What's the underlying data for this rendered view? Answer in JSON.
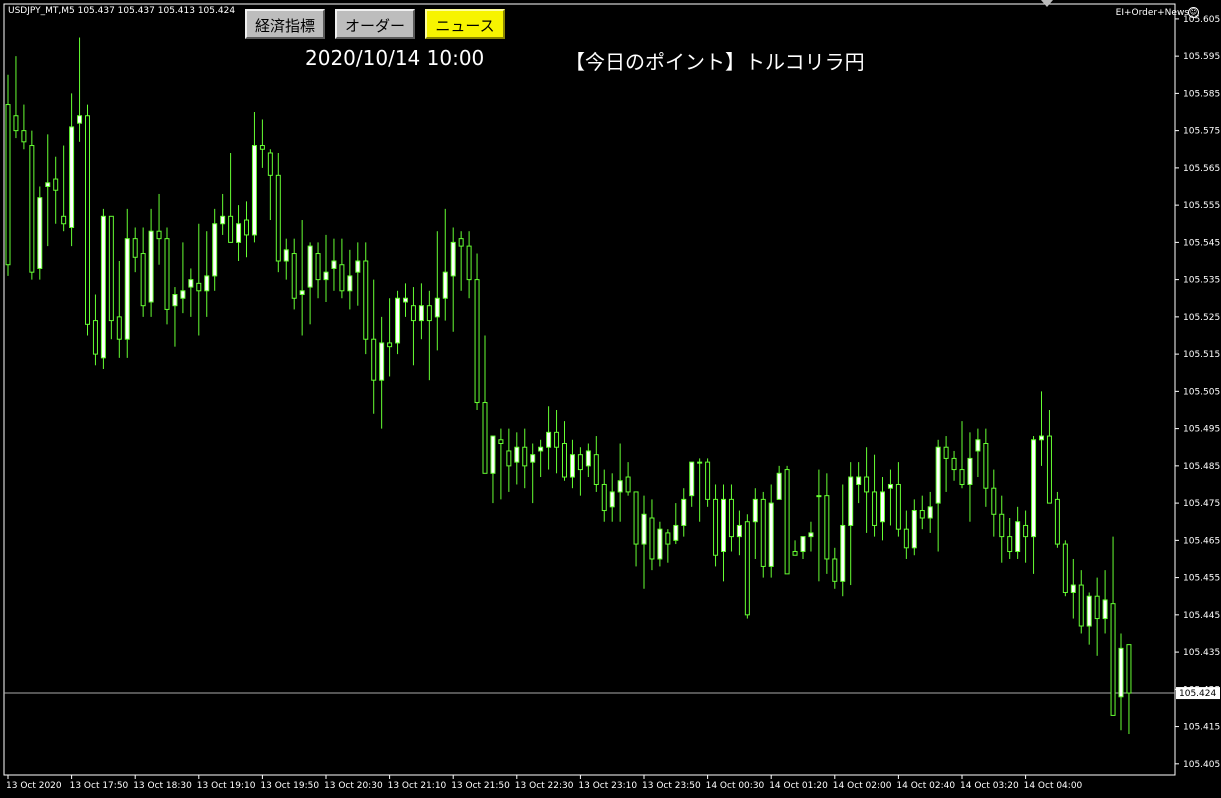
{
  "header": {
    "symbol_info": "USDJPY_MT,M5  105.437 105.437 105.413 105.424",
    "ea_label": "EI+Order+News",
    "ea_icon": "smiley-icon"
  },
  "buttons": {
    "indicators": "経済指標",
    "order": "オーダー",
    "news": "ニュース"
  },
  "news": {
    "time": "2020/10/14 10:00",
    "title": "【今日のポイント】トルコリラ円"
  },
  "colors": {
    "background": "#000000",
    "bull_body": "#ffffff",
    "bear_body": "#000000",
    "wick": "#66ff33",
    "axis": "#ffffff",
    "price_line": "#aaaaaa",
    "news_button": "#f7f400"
  },
  "chart_data": {
    "type": "candlestick",
    "symbol": "USDJPY_MT",
    "timeframe": "M5",
    "ylim": [
      105.402,
      105.609
    ],
    "yticks": [
      "105.605",
      "105.595",
      "105.585",
      "105.575",
      "105.565",
      "105.555",
      "105.545",
      "105.535",
      "105.525",
      "105.515",
      "105.505",
      "105.495",
      "105.485",
      "105.475",
      "105.465",
      "105.455",
      "105.445",
      "105.435",
      "105.425",
      "105.415",
      "105.405"
    ],
    "xticks": [
      {
        "label": "13 Oct 2020",
        "index": 0
      },
      {
        "label": "13 Oct 17:50",
        "index": 8
      },
      {
        "label": "13 Oct 18:30",
        "index": 16
      },
      {
        "label": "13 Oct 19:10",
        "index": 24
      },
      {
        "label": "13 Oct 19:50",
        "index": 32
      },
      {
        "label": "13 Oct 20:30",
        "index": 40
      },
      {
        "label": "13 Oct 21:10",
        "index": 48
      },
      {
        "label": "13 Oct 21:50",
        "index": 56
      },
      {
        "label": "13 Oct 22:30",
        "index": 64
      },
      {
        "label": "13 Oct 23:10",
        "index": 72
      },
      {
        "label": "13 Oct 23:50",
        "index": 80
      },
      {
        "label": "14 Oct 00:30",
        "index": 88
      },
      {
        "label": "14 Oct 01:20",
        "index": 96
      },
      {
        "label": "14 Oct 02:00",
        "index": 104
      },
      {
        "label": "14 Oct 02:40",
        "index": 112
      },
      {
        "label": "14 Oct 03:20",
        "index": 120
      },
      {
        "label": "14 Oct 04:00",
        "index": 128
      }
    ],
    "current_price": "105.424",
    "candles": [
      [
        105.582,
        105.59,
        105.536,
        105.539
      ],
      [
        105.579,
        105.595,
        105.573,
        105.575
      ],
      [
        105.575,
        105.582,
        105.57,
        105.572
      ],
      [
        105.571,
        105.575,
        105.535,
        105.537
      ],
      [
        105.538,
        105.56,
        105.535,
        105.557
      ],
      [
        105.56,
        105.574,
        105.544,
        105.561
      ],
      [
        105.562,
        105.568,
        105.55,
        105.559
      ],
      [
        105.552,
        105.571,
        105.548,
        105.55
      ],
      [
        105.549,
        105.585,
        105.544,
        105.576
      ],
      [
        105.577,
        105.6,
        105.572,
        105.579
      ],
      [
        105.579,
        105.582,
        105.52,
        105.523
      ],
      [
        105.524,
        105.531,
        105.512,
        105.515
      ],
      [
        105.514,
        105.554,
        105.511,
        105.552
      ],
      [
        105.552,
        105.552,
        105.519,
        105.524
      ],
      [
        105.525,
        105.54,
        105.514,
        105.519
      ],
      [
        105.519,
        105.554,
        105.514,
        105.546
      ],
      [
        105.546,
        105.549,
        105.537,
        105.541
      ],
      [
        105.542,
        105.549,
        105.525,
        105.528
      ],
      [
        105.529,
        105.554,
        105.525,
        105.548
      ],
      [
        105.548,
        105.558,
        105.539,
        105.546
      ],
      [
        105.546,
        105.549,
        105.523,
        105.527
      ],
      [
        105.528,
        105.533,
        105.517,
        105.531
      ],
      [
        105.53,
        105.545,
        105.526,
        105.532
      ],
      [
        105.533,
        105.538,
        105.525,
        105.535
      ],
      [
        105.534,
        105.55,
        105.52,
        105.532
      ],
      [
        105.532,
        105.548,
        105.525,
        105.536
      ],
      [
        105.536,
        105.554,
        105.532,
        105.55
      ],
      [
        105.55,
        105.558,
        105.547,
        105.552
      ],
      [
        105.552,
        105.569,
        105.545,
        105.545
      ],
      [
        105.545,
        105.555,
        105.54,
        105.55
      ],
      [
        105.551,
        105.556,
        105.541,
        105.547
      ],
      [
        105.547,
        105.58,
        105.545,
        105.571
      ],
      [
        105.571,
        105.578,
        105.565,
        105.57
      ],
      [
        105.569,
        105.57,
        105.551,
        105.563
      ],
      [
        105.563,
        105.569,
        105.537,
        105.54
      ],
      [
        105.54,
        105.546,
        105.535,
        105.543
      ],
      [
        105.542,
        105.546,
        105.527,
        105.53
      ],
      [
        105.531,
        105.551,
        105.52,
        105.532
      ],
      [
        105.533,
        105.545,
        105.523,
        105.544
      ],
      [
        105.542,
        105.545,
        105.53,
        105.535
      ],
      [
        105.535,
        105.547,
        105.529,
        105.537
      ],
      [
        105.538,
        105.546,
        105.532,
        105.54
      ],
      [
        105.539,
        105.546,
        105.53,
        105.532
      ],
      [
        105.532,
        105.543,
        105.527,
        105.536
      ],
      [
        105.537,
        105.545,
        105.528,
        105.54
      ],
      [
        105.54,
        105.545,
        105.515,
        105.519
      ],
      [
        105.519,
        105.535,
        105.499,
        105.508
      ],
      [
        105.508,
        105.525,
        105.495,
        105.518
      ],
      [
        105.518,
        105.53,
        105.509,
        105.517
      ],
      [
        105.518,
        105.532,
        105.515,
        105.53
      ],
      [
        105.529,
        105.534,
        105.525,
        105.53
      ],
      [
        105.528,
        105.533,
        105.512,
        105.524
      ],
      [
        105.524,
        105.534,
        105.519,
        105.528
      ],
      [
        105.528,
        105.532,
        105.508,
        105.524
      ],
      [
        105.525,
        105.548,
        105.516,
        105.53
      ],
      [
        105.53,
        105.554,
        105.524,
        105.537
      ],
      [
        105.536,
        105.549,
        105.521,
        105.545
      ],
      [
        105.546,
        105.548,
        105.532,
        105.544
      ],
      [
        105.544,
        105.548,
        105.53,
        105.535
      ],
      [
        105.535,
        105.542,
        105.5,
        105.502
      ],
      [
        105.502,
        105.52,
        105.495,
        105.483
      ],
      [
        105.483,
        105.493,
        105.475,
        105.493
      ],
      [
        105.492,
        105.495,
        105.476,
        105.491
      ],
      [
        105.489,
        105.495,
        105.478,
        105.485
      ],
      [
        105.486,
        105.494,
        105.48,
        105.49
      ],
      [
        105.49,
        105.495,
        105.479,
        105.485
      ],
      [
        105.486,
        105.491,
        105.475,
        105.488
      ],
      [
        105.489,
        105.492,
        105.482,
        105.49
      ],
      [
        105.49,
        105.501,
        105.484,
        105.494
      ],
      [
        105.494,
        105.5,
        105.483,
        105.49
      ],
      [
        105.491,
        105.497,
        105.481,
        105.482
      ],
      [
        105.482,
        105.492,
        105.479,
        105.488
      ],
      [
        105.488,
        105.49,
        105.477,
        105.484
      ],
      [
        105.485,
        105.491,
        105.482,
        105.489
      ],
      [
        105.488,
        105.493,
        105.478,
        105.48
      ],
      [
        105.48,
        105.484,
        105.47,
        105.473
      ],
      [
        105.474,
        105.483,
        105.47,
        105.478
      ],
      [
        105.478,
        105.491,
        105.47,
        105.481
      ],
      [
        105.482,
        105.486,
        105.477,
        105.478
      ],
      [
        105.478,
        105.478,
        105.458,
        105.464
      ],
      [
        105.464,
        105.477,
        105.452,
        105.472
      ],
      [
        105.471,
        105.476,
        105.457,
        105.46
      ],
      [
        105.46,
        105.47,
        105.458,
        105.468
      ],
      [
        105.467,
        105.468,
        105.459,
        105.464
      ],
      [
        105.465,
        105.475,
        105.464,
        105.469
      ],
      [
        105.469,
        105.479,
        105.466,
        105.476
      ],
      [
        105.477,
        105.486,
        105.474,
        105.486
      ],
      [
        105.486,
        105.487,
        105.47,
        105.486
      ],
      [
        105.486,
        105.487,
        105.474,
        105.476
      ],
      [
        105.476,
        105.48,
        105.458,
        105.461
      ],
      [
        105.462,
        105.48,
        105.454,
        105.476
      ],
      [
        105.476,
        105.48,
        105.462,
        105.466
      ],
      [
        105.466,
        105.473,
        105.461,
        105.469
      ],
      [
        105.47,
        105.472,
        105.444,
        105.445
      ],
      [
        105.47,
        105.479,
        105.46,
        105.476
      ],
      [
        105.476,
        105.478,
        105.455,
        105.458
      ],
      [
        105.458,
        105.48,
        105.455,
        105.475
      ],
      [
        105.476,
        105.485,
        105.476,
        105.483
      ],
      [
        105.484,
        105.485,
        105.456,
        105.456
      ],
      [
        105.462,
        105.465,
        105.461,
        105.461
      ],
      [
        105.462,
        105.466,
        105.46,
        105.466
      ],
      [
        105.466,
        105.47,
        105.462,
        105.467
      ],
      [
        105.477,
        105.484,
        105.454,
        105.477
      ],
      [
        105.477,
        105.483,
        105.456,
        105.46
      ],
      [
        105.46,
        105.463,
        105.452,
        105.454
      ],
      [
        105.454,
        105.48,
        105.45,
        105.469
      ],
      [
        105.469,
        105.486,
        105.453,
        105.482
      ],
      [
        105.48,
        105.486,
        105.475,
        105.482
      ],
      [
        105.482,
        105.49,
        105.467,
        105.478
      ],
      [
        105.478,
        105.488,
        105.466,
        105.469
      ],
      [
        105.47,
        105.482,
        105.465,
        105.478
      ],
      [
        105.479,
        105.484,
        105.469,
        105.48
      ],
      [
        105.48,
        105.486,
        105.466,
        105.468
      ],
      [
        105.468,
        105.473,
        105.46,
        105.463
      ],
      [
        105.463,
        105.476,
        105.461,
        105.473
      ],
      [
        105.473,
        105.477,
        105.468,
        105.471
      ],
      [
        105.471,
        105.478,
        105.467,
        105.474
      ],
      [
        105.475,
        105.492,
        105.462,
        105.49
      ],
      [
        105.49,
        105.493,
        105.478,
        105.487
      ],
      [
        105.487,
        105.489,
        105.481,
        105.484
      ],
      [
        105.484,
        105.497,
        105.479,
        105.48
      ],
      [
        105.48,
        105.494,
        105.47,
        105.487
      ],
      [
        105.489,
        105.495,
        105.482,
        105.492
      ],
      [
        105.491,
        105.495,
        105.474,
        105.479
      ],
      [
        105.479,
        105.484,
        105.466,
        105.472
      ],
      [
        105.472,
        105.477,
        105.459,
        105.466
      ],
      [
        105.466,
        105.471,
        105.46,
        105.462
      ],
      [
        105.462,
        105.474,
        105.46,
        105.47
      ],
      [
        105.469,
        105.473,
        105.459,
        105.466
      ],
      [
        105.466,
        105.493,
        105.456,
        105.492
      ],
      [
        105.492,
        105.505,
        105.485,
        105.493
      ],
      [
        105.493,
        105.5,
        105.476,
        105.475
      ],
      [
        105.476,
        105.478,
        105.463,
        105.464
      ],
      [
        105.464,
        105.465,
        105.45,
        105.451
      ],
      [
        105.451,
        105.46,
        105.444,
        105.453
      ],
      [
        105.453,
        105.457,
        105.44,
        105.442
      ],
      [
        105.442,
        105.451,
        105.437,
        105.45
      ],
      [
        105.45,
        105.455,
        105.434,
        105.444
      ],
      [
        105.444,
        105.457,
        105.44,
        105.449
      ],
      [
        105.448,
        105.466,
        105.442,
        105.418
      ],
      [
        105.423,
        105.44,
        105.414,
        105.436
      ],
      [
        105.437,
        105.437,
        105.413,
        105.424
      ]
    ]
  }
}
